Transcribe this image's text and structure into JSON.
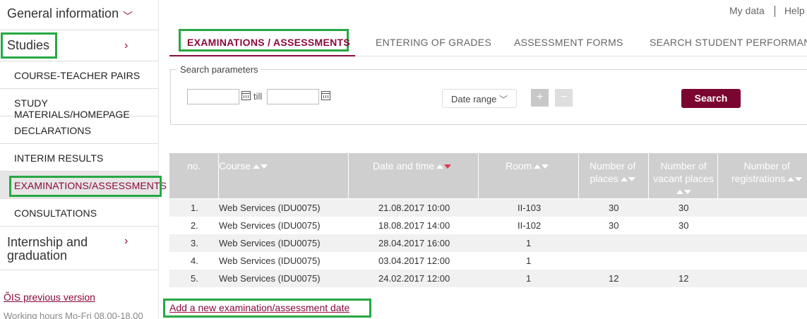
{
  "sidebar": {
    "general_info": "General information",
    "studies": "Studies",
    "items": [
      "COURSE-TEACHER PAIRS",
      "STUDY MATERIALS/HOMEPAGE",
      "DECLARATIONS",
      "INTERIM RESULTS",
      "EXAMINATIONS/ASSESSMENTS",
      "CONSULTATIONS"
    ],
    "internship_line1": "Internship and",
    "internship_line2": "graduation",
    "previous_version": "ÕIS previous version",
    "working_hours": "Working hours Mo-Fri 08.00-18.00"
  },
  "toplinks": {
    "my_data": "My data",
    "help": "Help"
  },
  "tabs": [
    "EXAMINATIONS / ASSESSMENTS",
    "ENTERING OF GRADES",
    "ASSESSMENT FORMS",
    "SEARCH STUDENT PERFORMANCE"
  ],
  "search": {
    "legend": "Search parameters",
    "from_value": "",
    "to_value": "",
    "till": "till",
    "range_select": "Date range",
    "plus": "+",
    "minus": "−",
    "button": "Search"
  },
  "table": {
    "headers": {
      "no": "no.",
      "course": "Course",
      "date": "Date and time",
      "room": "Room",
      "places_1": "Number of",
      "places_2": "places",
      "vacant_1": "Number of",
      "vacant_2": "vacant places",
      "reg_1": "Number of",
      "reg_2": "registrations"
    },
    "rows": [
      {
        "no": "1.",
        "course": "Web Services (IDU0075)",
        "date": "21.08.2017 10:00",
        "room": "II-103",
        "places": "30",
        "vacant": "30",
        "reg": ""
      },
      {
        "no": "2.",
        "course": "Web Services (IDU0075)",
        "date": "18.08.2017 14:00",
        "room": "II-102",
        "places": "30",
        "vacant": "30",
        "reg": ""
      },
      {
        "no": "3.",
        "course": "Web Services (IDU0075)",
        "date": "28.04.2017 16:00",
        "room": "1",
        "places": "",
        "vacant": "",
        "reg": ""
      },
      {
        "no": "4.",
        "course": "Web Services (IDU0075)",
        "date": "03.04.2017 12:00",
        "room": "1",
        "places": "",
        "vacant": "",
        "reg": ""
      },
      {
        "no": "5.",
        "course": "Web Services (IDU0075)",
        "date": "24.02.2017 12:00",
        "room": "1",
        "places": "12",
        "vacant": "12",
        "reg": ""
      }
    ]
  },
  "add_link": "Add a new examination/assessment date",
  "colors": {
    "accent": "#8a0a3c",
    "highlight": "#27a844",
    "header_bg": "#cfcfcf"
  }
}
